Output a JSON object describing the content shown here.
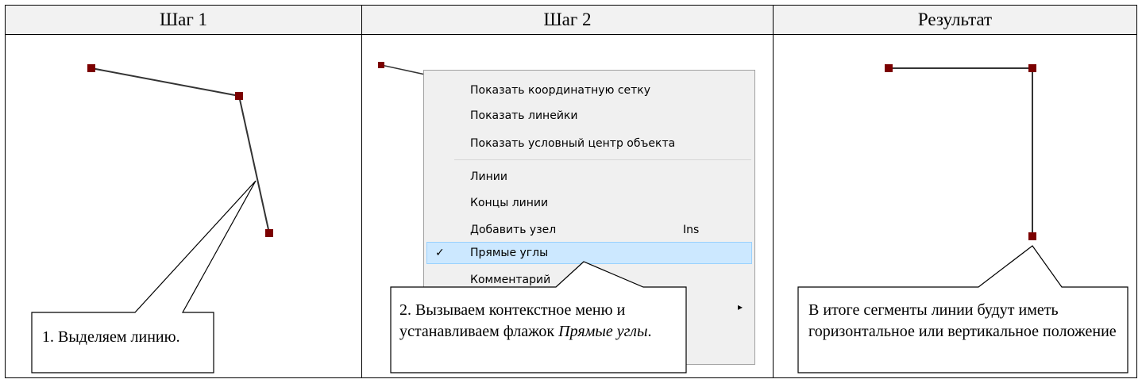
{
  "table": {
    "headers": [
      "Шаг 1",
      "Шаг 2",
      "Результат"
    ]
  },
  "step1": {
    "callout": "1. Выделяем линию."
  },
  "step2": {
    "callout_text": "2. Вызываем контекстное меню и устанавливаем флажок ",
    "callout_italic": "Прямые углы",
    "callout_end": ".",
    "menu": {
      "items": [
        {
          "label": "Показать координатную сетку"
        },
        {
          "label": "Показать линейки"
        },
        {
          "label": "Показать условный центр объекта"
        },
        {
          "label": "Линии"
        },
        {
          "label": "Концы линии"
        },
        {
          "label": "Добавить узел",
          "shortcut": "Ins"
        },
        {
          "label": "Прямые углы",
          "checked": true
        },
        {
          "label": "Комментарий"
        }
      ],
      "check_glyph": "✓",
      "submenu_arrow": "▸"
    }
  },
  "result": {
    "callout": "В итоге сегменты линии будут иметь горизонтальное или вертикальное положение"
  },
  "colors": {
    "node": "#7b0000",
    "header_bg": "#f2f2f2",
    "menu_bg": "#f0f0f0",
    "menu_highlight": "#cce8ff"
  }
}
